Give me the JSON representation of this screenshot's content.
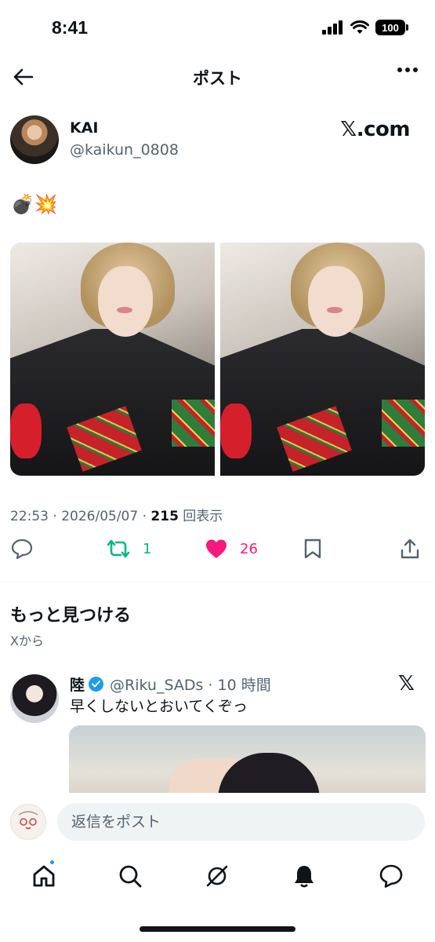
{
  "status_bar": {
    "time": "8:41",
    "battery": "100"
  },
  "header": {
    "title": "ポスト"
  },
  "post": {
    "author_name": "KAI",
    "author_handle": "@kaikun_0808",
    "watermark": "𝕏.com",
    "text": "💣💥",
    "meta_time": "22:53 · 2026/05/07 · ",
    "views_count": "215",
    "views_label": " 回表示",
    "retweets": "1",
    "likes": "26"
  },
  "discover": {
    "title": "もっと見つける",
    "subtitle": "Xから"
  },
  "suggested_post": {
    "name": "陸",
    "handle": "@Riku_SADs · 10 時間",
    "x_logo": "𝕏",
    "text": "早くしないとおいてくぞっ"
  },
  "reply": {
    "placeholder": "返信をポスト"
  },
  "colors": {
    "accent": "#1d9bf0",
    "retweet_green": "#00ba7c",
    "like_pink": "#f91880",
    "text": "#0f1419",
    "muted": "#536471"
  },
  "icons": [
    "back-arrow-icon",
    "more-icon",
    "reply-icon",
    "retweet-icon",
    "heart-icon",
    "bookmark-icon",
    "share-icon",
    "verified-icon",
    "home-icon",
    "search-icon",
    "grok-icon",
    "bell-icon",
    "messages-icon"
  ]
}
